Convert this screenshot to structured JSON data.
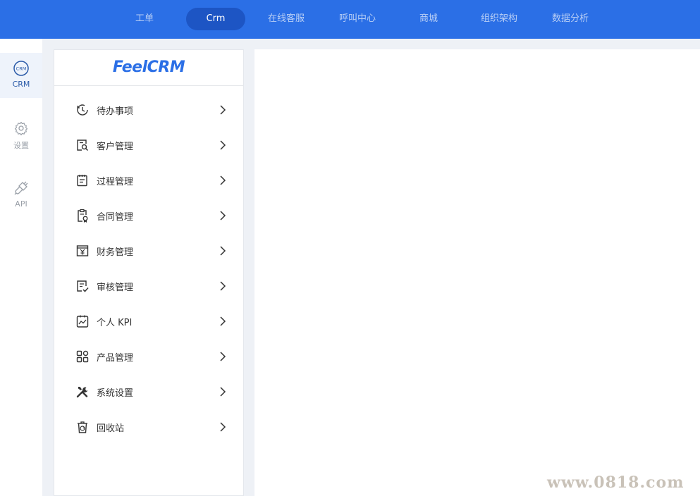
{
  "topnav": {
    "items": [
      {
        "label": "工单"
      },
      {
        "label": "Crm"
      },
      {
        "label": "在线客服"
      },
      {
        "label": "呼叫中心"
      },
      {
        "label": "商城"
      },
      {
        "label": "组织架构"
      },
      {
        "label": "数据分析"
      }
    ],
    "active_index": 1
  },
  "rail": {
    "items": [
      {
        "label": "CRM",
        "icon": "crm-icon"
      },
      {
        "label": "设置",
        "icon": "gear-icon"
      },
      {
        "label": "API",
        "icon": "plug-icon"
      }
    ],
    "active_index": 0
  },
  "logo": {
    "brand_feel": "Feel",
    "brand_crm": "CRM"
  },
  "menu": {
    "items": [
      {
        "label": "待办事项",
        "icon": "clock-icon"
      },
      {
        "label": "客户管理",
        "icon": "customer-search-icon"
      },
      {
        "label": "过程管理",
        "icon": "notepad-icon"
      },
      {
        "label": "合同管理",
        "icon": "contract-icon"
      },
      {
        "label": "财务管理",
        "icon": "finance-yen-icon"
      },
      {
        "label": "审核管理",
        "icon": "audit-icon"
      },
      {
        "label": "个人 KPI",
        "icon": "kpi-chart-icon"
      },
      {
        "label": "产品管理",
        "icon": "product-grid-icon"
      },
      {
        "label": "系统设置",
        "icon": "tools-icon"
      },
      {
        "label": "回收站",
        "icon": "recycle-bin-icon"
      }
    ]
  },
  "watermark": "www.0818.com",
  "colors": {
    "topbar": "#2b6fe6",
    "topnav_active": "#1d55c4",
    "brand": "#2b6fe6"
  }
}
